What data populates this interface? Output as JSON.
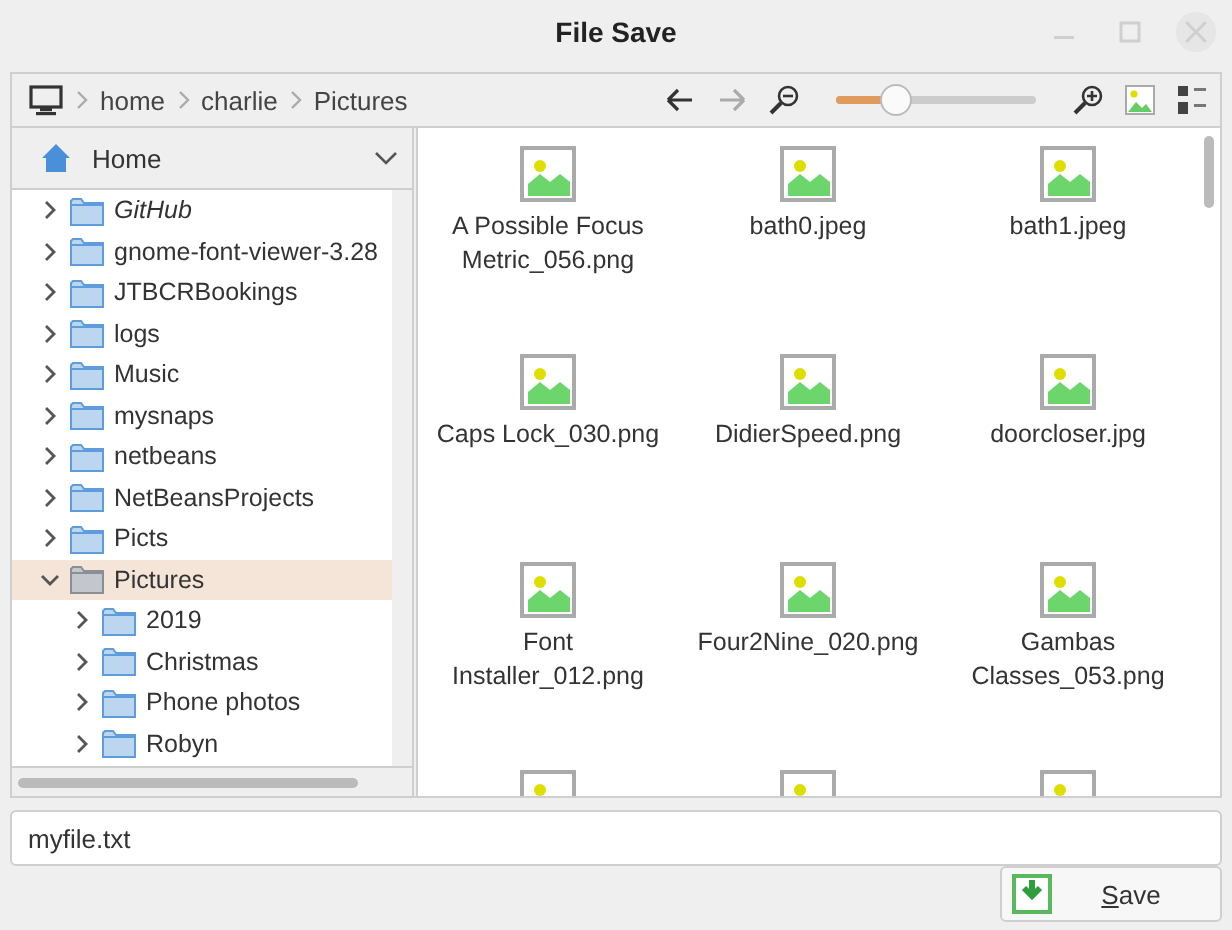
{
  "window": {
    "title": "File Save"
  },
  "breadcrumb": [
    {
      "label": "home"
    },
    {
      "label": "charlie"
    },
    {
      "label": "Pictures"
    }
  ],
  "toolbar": {
    "back_disabled": false,
    "forward_disabled": true,
    "zoom": {
      "level": 0.24
    }
  },
  "places": {
    "label": "Home"
  },
  "tree": [
    {
      "label": "GitHub",
      "italic": true,
      "expanded": false,
      "selected": false
    },
    {
      "label": "gnome-font-viewer-3.28",
      "expanded": false,
      "selected": false
    },
    {
      "label": "JTBCRBookings",
      "expanded": false,
      "selected": false
    },
    {
      "label": "logs",
      "expanded": false,
      "selected": false
    },
    {
      "label": "Music",
      "expanded": false,
      "selected": false
    },
    {
      "label": "mysnaps",
      "expanded": false,
      "selected": false
    },
    {
      "label": "netbeans",
      "expanded": false,
      "selected": false
    },
    {
      "label": "NetBeansProjects",
      "expanded": false,
      "selected": false
    },
    {
      "label": "Picts",
      "expanded": false,
      "selected": false
    },
    {
      "label": "Pictures",
      "expanded": true,
      "selected": true,
      "children": [
        {
          "label": "2019",
          "expanded": false,
          "selected": false
        },
        {
          "label": "Christmas",
          "expanded": false,
          "selected": false
        },
        {
          "label": "Phone photos",
          "expanded": false,
          "selected": false
        },
        {
          "label": "Robyn",
          "expanded": false,
          "selected": false
        }
      ]
    }
  ],
  "files": [
    {
      "kind": "named",
      "name": "A Possible Focus Metric_056.png"
    },
    {
      "kind": "named",
      "name": "bath0.jpeg"
    },
    {
      "kind": "named",
      "name": "bath1.jpeg"
    },
    {
      "kind": "named",
      "name": "Caps Lock_030.png"
    },
    {
      "kind": "named",
      "name": "DidierSpeed.png"
    },
    {
      "kind": "named",
      "name": "doorcloser.jpg"
    },
    {
      "kind": "named",
      "name": "Font Installer_012.png"
    },
    {
      "kind": "named",
      "name": "Four2Nine_020.png"
    },
    {
      "kind": "named",
      "name": "Gambas Classes_053.png"
    },
    {
      "kind": "cut"
    },
    {
      "kind": "cut"
    },
    {
      "kind": "cut"
    }
  ],
  "filename": {
    "value": "myfile.txt"
  },
  "buttons": [
    {
      "label": "Save"
    }
  ]
}
